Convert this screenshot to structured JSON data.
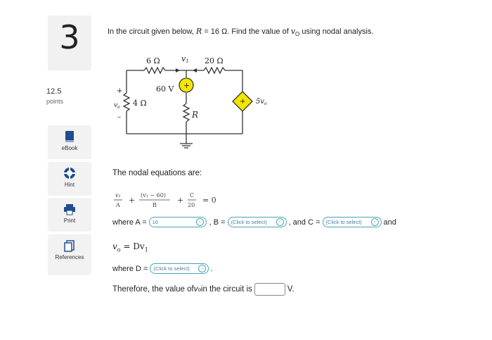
{
  "question_number": "3",
  "points": {
    "value": "12.5",
    "label": "points"
  },
  "sidebar": [
    {
      "name": "ebook",
      "label": "eBook"
    },
    {
      "name": "hint",
      "label": "Hint"
    },
    {
      "name": "print",
      "label": "Print"
    },
    {
      "name": "references",
      "label": "References"
    }
  ],
  "question": {
    "prefix": "In the circuit given below, ",
    "r_var": "R",
    "r_value": " = 16 Ω. Find the value of ",
    "vo_var": "v",
    "vo_sub": "O",
    "suffix": " using nodal analysis."
  },
  "circuit": {
    "r6": "6 Ω",
    "v1": "v",
    "v1_sub": "1",
    "r20": "20 Ω",
    "src60": "60 V",
    "r4": "4 Ω",
    "vo": "v",
    "vo_sub": "o",
    "plus": "+",
    "minus": "–",
    "r": "R",
    "dep": "5v",
    "dep_sub": "o"
  },
  "nodal": {
    "intro": "The nodal equations are:"
  },
  "equation": {
    "t1_num": "v₁",
    "t1_den": "A",
    "t2_num": "(v₁ − 60)",
    "t2_den": "B",
    "t3_num": "C",
    "t3_den": "20",
    "plus": "+",
    "equals": "= 0"
  },
  "where": {
    "a_label": "where A =",
    "a_value": "16",
    "b_label": ", B =",
    "b_value": "(Click to select)",
    "c_label": ", and C =",
    "c_value": "(Click to select)",
    "and": "and"
  },
  "vo_eq": {
    "text": "v",
    "sub": "o",
    "rest": " = Dv",
    "sub1": "1"
  },
  "where_d": {
    "label": "where D =",
    "value": "(Click to select)",
    "end": "."
  },
  "therefore": {
    "prefix": "Therefore, the value of ",
    "var": "v",
    "sub": "o",
    "mid": " in the circuit is",
    "unit": "V."
  },
  "colors": {
    "accent": "#4aa3b8",
    "source_fill": "#f3e600",
    "dep_fill": "#f3e600",
    "sidebar_bg": "#f2f2f2"
  }
}
